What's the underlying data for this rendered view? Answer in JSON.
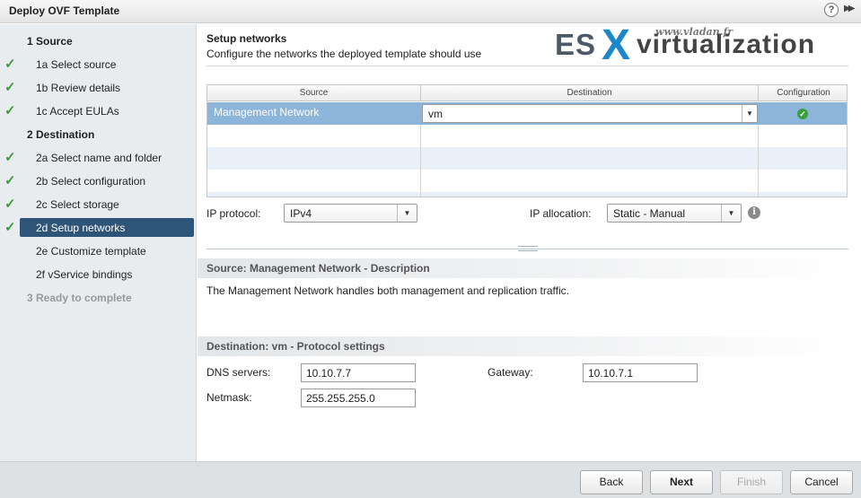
{
  "window": {
    "title": "Deploy OVF Template",
    "help_glyph": "?",
    "expand_glyph": "▶▶"
  },
  "sidebar": {
    "steps": [
      {
        "label": "1  Source",
        "state": "heading"
      },
      {
        "label": "1a  Select source",
        "state": "done"
      },
      {
        "label": "1b  Review details",
        "state": "done"
      },
      {
        "label": "1c  Accept EULAs",
        "state": "done"
      },
      {
        "label": "2  Destination",
        "state": "heading"
      },
      {
        "label": "2a  Select name and folder",
        "state": "done"
      },
      {
        "label": "2b  Select configuration",
        "state": "done"
      },
      {
        "label": "2c  Select storage",
        "state": "done"
      },
      {
        "label": "2d  Setup networks",
        "state": "active"
      },
      {
        "label": "2e  Customize template",
        "state": "pending"
      },
      {
        "label": "2f  vService bindings",
        "state": "pending"
      },
      {
        "label": "3  Ready to complete",
        "state": "disabled"
      }
    ]
  },
  "watermark": {
    "site": "www.vladan.fr",
    "es": "ES",
    "x": "X",
    "virt": "virtualization"
  },
  "main": {
    "title": "Setup networks",
    "subtitle": "Configure the networks the deployed template should use",
    "table": {
      "columns": [
        "Source",
        "Destination",
        "Configuration"
      ],
      "rows": [
        {
          "source": "Management Network",
          "destination": "vm",
          "configuration": "ok"
        }
      ]
    },
    "ip_protocol": {
      "label": "IP protocol:",
      "value": "IPv4"
    },
    "ip_allocation": {
      "label": "IP allocation:",
      "value": "Static - Manual"
    },
    "description_heading": "Source: Management Network - Description",
    "description_text": "The Management Network handles both management and replication traffic.",
    "protocol_heading": "Destination: vm - Protocol settings",
    "dns": {
      "label": "DNS servers:",
      "value": "10.10.7.7"
    },
    "gateway": {
      "label": "Gateway:",
      "value": "10.10.7.1"
    },
    "netmask": {
      "label": "Netmask:",
      "value": "255.255.255.0"
    }
  },
  "footer": {
    "back": "Back",
    "next": "Next",
    "finish": "Finish",
    "cancel": "Cancel"
  },
  "colors": {
    "selected_step": "#2e5478",
    "selected_row": "#8db4d9",
    "check": "#3d9b3d",
    "logo_x": "#1d88c9"
  },
  "icons": {
    "help": "help-icon",
    "expand": "expand-icon",
    "check": "checkmark-icon",
    "config_ok": "check-circle-icon",
    "dropdown": "chevron-down-icon",
    "info": "info-icon"
  }
}
